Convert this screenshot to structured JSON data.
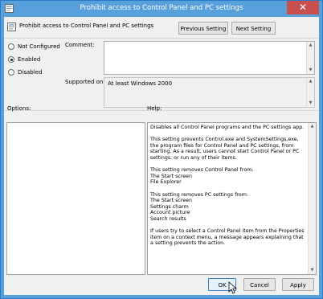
{
  "window": {
    "title": "Prohibit access to Control Panel and PC settings",
    "close_glyph": "✕"
  },
  "policy": {
    "name": "Prohibit access to Control Panel and PC settings"
  },
  "nav": {
    "previous_label": "Previous Setting",
    "next_label": "Next Setting"
  },
  "state": {
    "options": [
      "Not Configured",
      "Enabled",
      "Disabled"
    ],
    "selected": "Enabled"
  },
  "comment": {
    "label": "Comment:",
    "value": ""
  },
  "supported": {
    "label": "Supported on:",
    "value": "At least Windows 2000"
  },
  "sections": {
    "options_label": "Options:",
    "help_label": "Help:"
  },
  "help": {
    "p1": "Disables all Control Panel programs and the PC settings app.",
    "p2": "This setting prevents Control.exe and SystemSettings.exe, the program files for Control Panel and PC settings, from starting. As a result, users cannot start Control Panel or PC settings, or run any of their items.",
    "p3_head": "This setting removes Control Panel from:",
    "p3_items": [
      "The Start screen",
      "File Explorer"
    ],
    "p4_head": "This setting removes PC settings from:",
    "p4_items": [
      "The Start screen",
      "Settings charm",
      "Account picture",
      "Search results"
    ],
    "p5": "If users try to select a Control Panel item from the Properties item on a context menu, a message appears explaining that a setting prevents the action."
  },
  "footer": {
    "ok_label": "OK",
    "cancel_label": "Cancel",
    "apply_label": "Apply"
  },
  "icons": {
    "title": "policy-icon",
    "policy": "policy-icon",
    "close": "close-icon",
    "cursor": "mouse-pointer-icon"
  }
}
